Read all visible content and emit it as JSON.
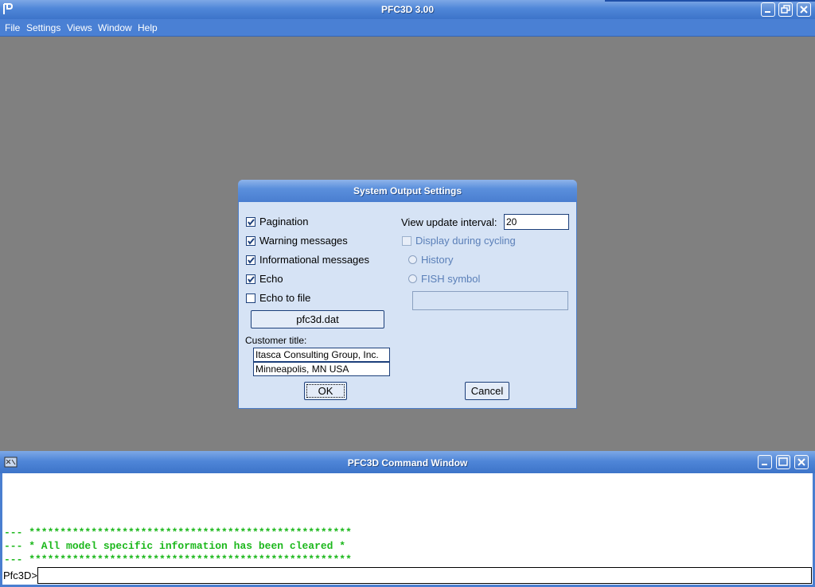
{
  "app": {
    "title": "PFC3D 3.00"
  },
  "menu": [
    {
      "label": "File"
    },
    {
      "label": "Settings"
    },
    {
      "label": "Views"
    },
    {
      "label": "Window"
    },
    {
      "label": "Help"
    }
  ],
  "dialog": {
    "title": "System Output Settings",
    "checkboxes": [
      {
        "label": "Pagination",
        "checked": true
      },
      {
        "label": "Warning messages",
        "checked": true
      },
      {
        "label": "Informational messages",
        "checked": true
      },
      {
        "label": "Echo",
        "checked": true
      },
      {
        "label": "Echo to file",
        "checked": false
      }
    ],
    "echo_file_button": "pfc3d.dat",
    "customer_title_label": "Customer title:",
    "customer_title_line1": "Itasca Consulting Group, Inc.",
    "customer_title_line2": "Minneapolis, MN  USA",
    "view_update_label": "View update interval:",
    "view_update_value": "20",
    "display_during_cycling": {
      "label": "Display during cycling",
      "checked": false,
      "enabled": false
    },
    "radio_history": "History",
    "radio_fish": "FISH symbol",
    "fish_symbol_value": "",
    "ok_label": "OK",
    "cancel_label": "Cancel"
  },
  "command_window": {
    "title": "PFC3D Command Window",
    "lines": [
      "--- ****************************************************",
      "--- * All model specific information has been cleared *",
      "--- ****************************************************"
    ],
    "prompt": "Pfc3D>",
    "input_value": ""
  },
  "colors": {
    "titlebar": "#4f86d8",
    "desktop": "#808080",
    "dialog_bg": "#d6e3f5",
    "console_text": "#1cb81c"
  }
}
